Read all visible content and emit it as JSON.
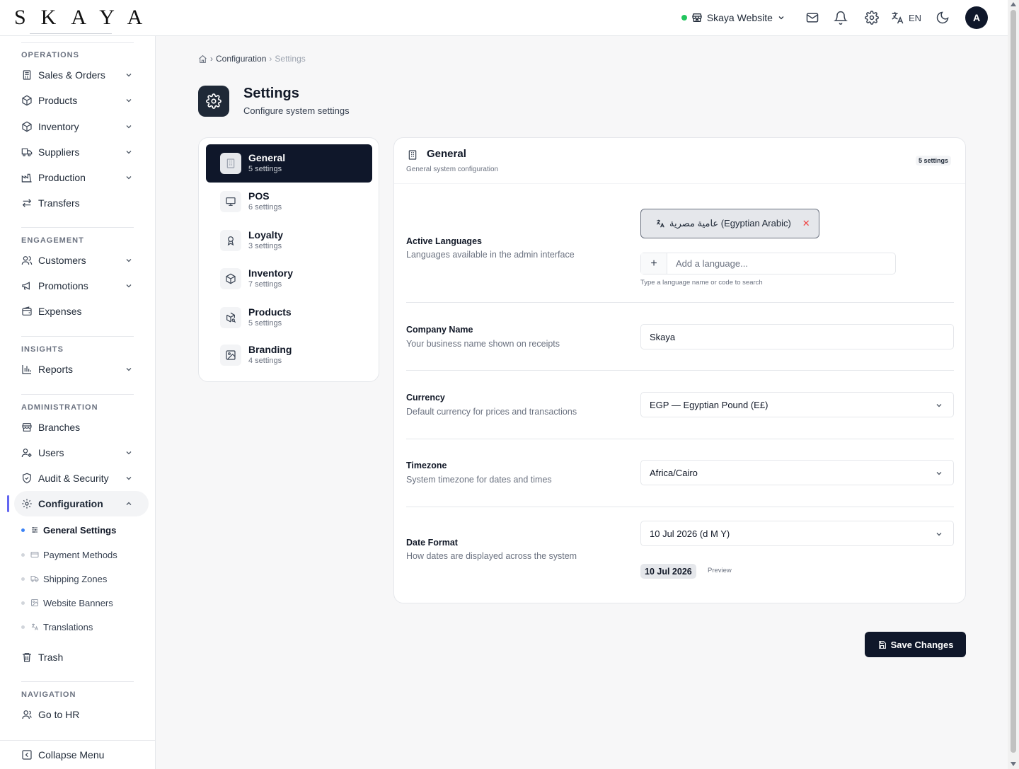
{
  "brand": {
    "logo": "SKAYA"
  },
  "topbar": {
    "site_selector": "Skaya Website",
    "language": "EN",
    "avatar_initial": "A"
  },
  "sidebar": {
    "sections": [
      "OPERATIONS",
      "ENGAGEMENT",
      "INSIGHTS",
      "ADMINISTRATION",
      "NAVIGATION"
    ],
    "items": {
      "sales_orders": "Sales & Orders",
      "products": "Products",
      "inventory": "Inventory",
      "suppliers": "Suppliers",
      "production": "Production",
      "transfers": "Transfers",
      "customers": "Customers",
      "promotions": "Promotions",
      "expenses": "Expenses",
      "reports": "Reports",
      "branches": "Branches",
      "users": "Users",
      "audit_security": "Audit & Security",
      "configuration": "Configuration",
      "trash": "Trash",
      "go_to_hr": "Go to HR"
    },
    "config_sub": [
      "General Settings",
      "Payment Methods",
      "Shipping Zones",
      "Website Banners",
      "Translations"
    ],
    "collapse": "Collapse Menu"
  },
  "breadcrumb": {
    "parent": "Configuration",
    "current": "Settings"
  },
  "page": {
    "title": "Settings",
    "subtitle": "Configure system settings"
  },
  "categories": [
    {
      "title": "General",
      "count": "5 settings"
    },
    {
      "title": "POS",
      "count": "6 settings"
    },
    {
      "title": "Loyalty",
      "count": "3 settings"
    },
    {
      "title": "Inventory",
      "count": "7 settings"
    },
    {
      "title": "Products",
      "count": "5 settings"
    },
    {
      "title": "Branding",
      "count": "4 settings"
    }
  ],
  "panel": {
    "title": "General",
    "subtitle": "General system configuration",
    "badge": "5 settings",
    "active_languages": {
      "label": "Active Languages",
      "desc": "Languages available in the admin interface",
      "chip": "عامية مصرية (Egyptian Arabic)",
      "add_placeholder": "Add a language...",
      "hint": "Type a language name or code to search"
    },
    "company_name": {
      "label": "Company Name",
      "desc": "Your business name shown on receipts",
      "value": "Skaya"
    },
    "currency": {
      "label": "Currency",
      "desc": "Default currency for prices and transactions",
      "value": "EGP — Egyptian Pound (E£)"
    },
    "timezone": {
      "label": "Timezone",
      "desc": "System timezone for dates and times",
      "value": "Africa/Cairo"
    },
    "date_format": {
      "label": "Date Format",
      "desc": "How dates are displayed across the system",
      "value": "10 Jul 2026 (d M Y)",
      "preview": "10 Jul 2026",
      "preview_label": "Preview"
    }
  },
  "actions": {
    "save": "Save Changes"
  },
  "colors": {
    "accent": "#0f172a",
    "active_indicator": "#6366f1",
    "status_online": "#22c55e",
    "remove": "#ef4444"
  }
}
